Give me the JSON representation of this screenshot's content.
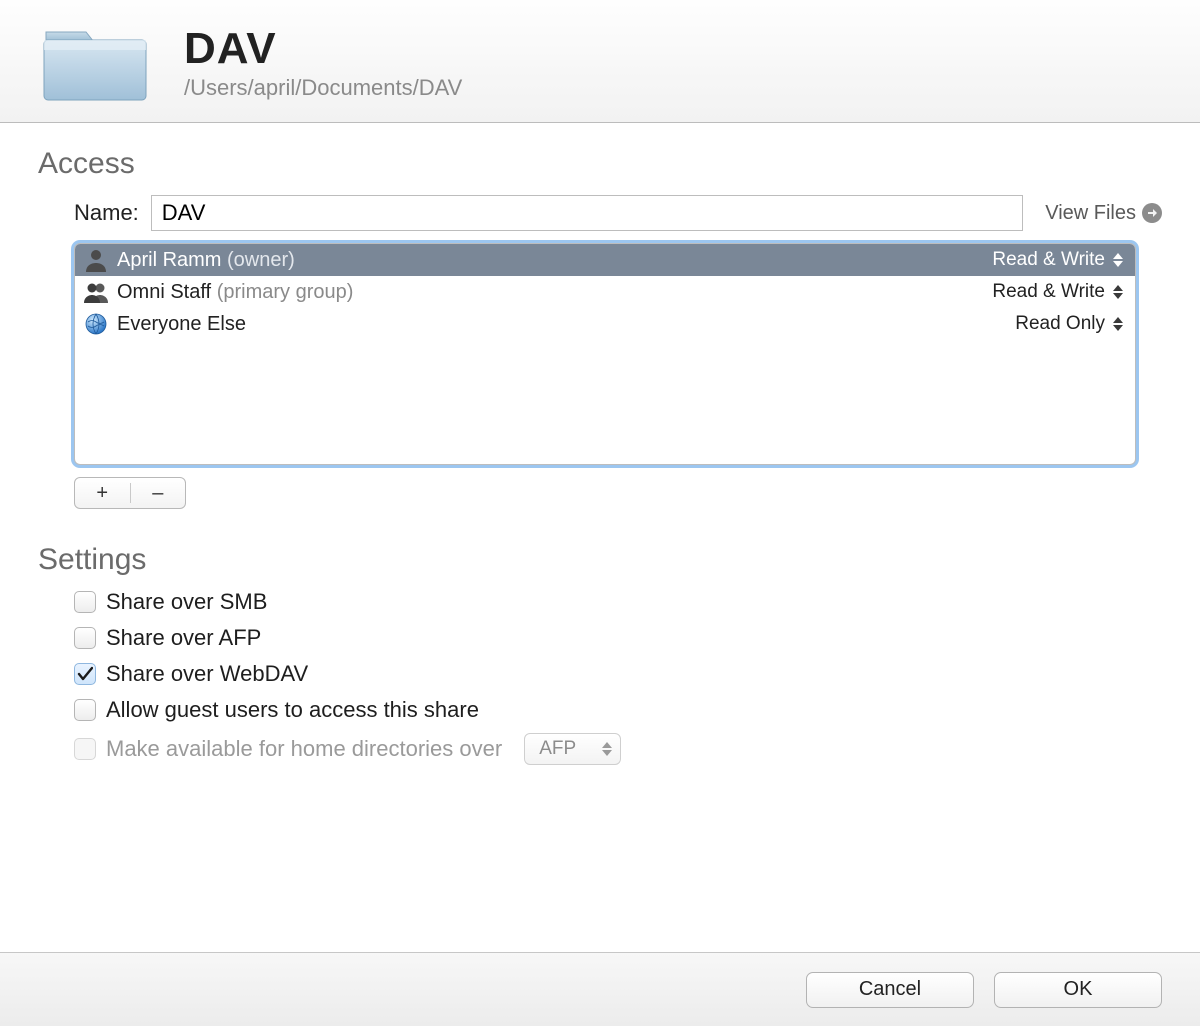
{
  "header": {
    "title": "DAV",
    "path": "/Users/april/Documents/DAV"
  },
  "access": {
    "section_label": "Access",
    "name_label": "Name:",
    "name_value": "DAV",
    "view_files_label": "View Files",
    "entries": [
      {
        "name": "April Ramm",
        "suffix": "(owner)",
        "permission": "Read & Write",
        "icon": "user",
        "selected": true
      },
      {
        "name": "Omni Staff",
        "suffix": "(primary group)",
        "permission": "Read & Write",
        "icon": "group",
        "selected": false
      },
      {
        "name": "Everyone Else",
        "suffix": "",
        "permission": "Read Only",
        "icon": "globe",
        "selected": false
      }
    ],
    "add_label": "+",
    "remove_label": "–"
  },
  "settings": {
    "section_label": "Settings",
    "options": [
      {
        "label": "Share over SMB",
        "checked": false,
        "disabled": false
      },
      {
        "label": "Share over AFP",
        "checked": false,
        "disabled": false
      },
      {
        "label": "Share over WebDAV",
        "checked": true,
        "disabled": false
      },
      {
        "label": "Allow guest users to access this share",
        "checked": false,
        "disabled": false
      },
      {
        "label": "Make available for home directories over",
        "checked": false,
        "disabled": true
      }
    ],
    "home_dir_protocol": "AFP"
  },
  "footer": {
    "cancel": "Cancel",
    "ok": "OK"
  }
}
